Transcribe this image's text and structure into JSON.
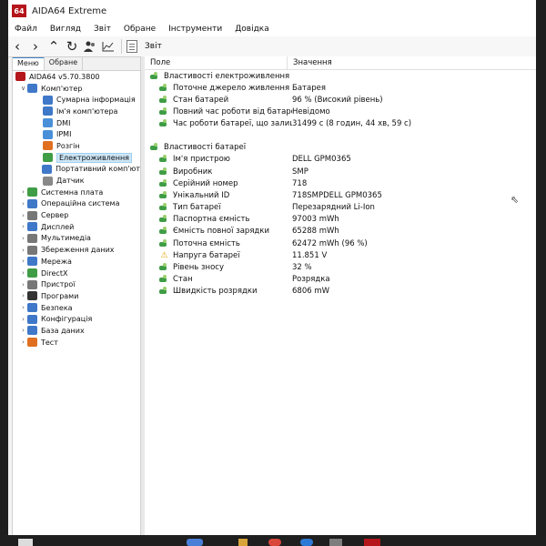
{
  "window": {
    "title": "AIDA64 Extreme",
    "logo": "64"
  },
  "menu": [
    "Файл",
    "Вигляд",
    "Звіт",
    "Обране",
    "Інструменти",
    "Довідка"
  ],
  "toolbar": {
    "report_label": "Звіт",
    "icons": [
      "back-arrow-icon",
      "forward-arrow-icon",
      "up-arrow-icon",
      "refresh-icon",
      "users-icon",
      "chart-icon"
    ]
  },
  "left_panel": {
    "tabs": [
      "Меню",
      "Обране"
    ],
    "tree": [
      {
        "label": "AIDA64 v5.70.3800",
        "icon": "aida-icon",
        "indent": 0,
        "chevron": "",
        "color": "#b5161b"
      },
      {
        "label": "Комп'ютер",
        "icon": "computer-icon",
        "indent": 1,
        "chevron": "v",
        "color": "#3f78c8"
      },
      {
        "label": "Сумарна інформація",
        "icon": "summary-icon",
        "indent": 2,
        "chevron": "",
        "color": "#3f78c8"
      },
      {
        "label": "Ім'я комп'ютера",
        "icon": "computer-name-icon",
        "indent": 2,
        "chevron": "",
        "color": "#3f78c8"
      },
      {
        "label": "DMI",
        "icon": "dmi-icon",
        "indent": 2,
        "chevron": "",
        "color": "#4a90d9"
      },
      {
        "label": "IPMI",
        "icon": "ipmi-icon",
        "indent": 2,
        "chevron": "",
        "color": "#4a90d9"
      },
      {
        "label": "Розгін",
        "icon": "overclock-icon",
        "indent": 2,
        "chevron": "",
        "color": "#e07020"
      },
      {
        "label": "Електроживлення",
        "icon": "power-icon",
        "indent": 2,
        "chevron": "",
        "color": "#3f9d46",
        "selected": true
      },
      {
        "label": "Портативний комп'ют",
        "icon": "portable-icon",
        "indent": 2,
        "chevron": "",
        "color": "#3f78c8"
      },
      {
        "label": "Датчик",
        "icon": "sensor-icon",
        "indent": 2,
        "chevron": "",
        "color": "#888888"
      },
      {
        "label": "Системна плата",
        "icon": "motherboard-icon",
        "indent": 1,
        "chevron": ">",
        "color": "#3f9d46"
      },
      {
        "label": "Операційна система",
        "icon": "os-icon",
        "indent": 1,
        "chevron": ">",
        "color": "#3f78c8"
      },
      {
        "label": "Сервер",
        "icon": "server-icon",
        "indent": 1,
        "chevron": ">",
        "color": "#777777"
      },
      {
        "label": "Дисплей",
        "icon": "display-icon",
        "indent": 1,
        "chevron": ">",
        "color": "#3f78c8"
      },
      {
        "label": "Мультимедіа",
        "icon": "multimedia-icon",
        "indent": 1,
        "chevron": ">",
        "color": "#777777"
      },
      {
        "label": "Збереження даних",
        "icon": "storage-icon",
        "indent": 1,
        "chevron": ">",
        "color": "#777777"
      },
      {
        "label": "Мережа",
        "icon": "network-icon",
        "indent": 1,
        "chevron": ">",
        "color": "#3f78c8"
      },
      {
        "label": "DirectX",
        "icon": "directx-icon",
        "indent": 1,
        "chevron": ">",
        "color": "#3f9d46"
      },
      {
        "label": "Пристрої",
        "icon": "devices-icon",
        "indent": 1,
        "chevron": ">",
        "color": "#777777"
      },
      {
        "label": "Програми",
        "icon": "programs-icon",
        "indent": 1,
        "chevron": ">",
        "color": "#333333"
      },
      {
        "label": "Безпека",
        "icon": "security-icon",
        "indent": 1,
        "chevron": ">",
        "color": "#3f78c8"
      },
      {
        "label": "Конфігурація",
        "icon": "config-icon",
        "indent": 1,
        "chevron": ">",
        "color": "#3f78c8"
      },
      {
        "label": "База даних",
        "icon": "database-icon",
        "indent": 1,
        "chevron": ">",
        "color": "#3f78c8"
      },
      {
        "label": "Тест",
        "icon": "test-icon",
        "indent": 1,
        "chevron": ">",
        "color": "#e07020"
      }
    ]
  },
  "right_panel": {
    "columns": [
      "Поле",
      "Значення"
    ],
    "groups": [
      {
        "title": "Властивості електроживлення",
        "rows": [
          {
            "field": "Поточне джерело живлення",
            "value": "Батарея",
            "icon": "power-prop-icon"
          },
          {
            "field": "Стан батарей",
            "value": "96 % (Високий рівень)",
            "icon": "power-prop-icon"
          },
          {
            "field": "Повний час роботи від батареї",
            "value": "Невідомо",
            "icon": "power-prop-icon"
          },
          {
            "field": "Час роботи батареї, що залиш...",
            "value": "31499 с (8 годин, 44 хв, 59 с)",
            "icon": "power-prop-icon"
          }
        ]
      },
      {
        "title": "Властивості батареї",
        "rows": [
          {
            "field": "Ім'я пристрою",
            "value": "DELL GPM0365",
            "icon": "battery-prop-icon"
          },
          {
            "field": "Виробник",
            "value": "SMP",
            "icon": "battery-prop-icon"
          },
          {
            "field": "Серійний номер",
            "value": "718",
            "icon": "battery-prop-icon"
          },
          {
            "field": "Унікальний ID",
            "value": "718SMPDELL GPM0365",
            "icon": "battery-prop-icon"
          },
          {
            "field": "Тип батареї",
            "value": "Перезарядний Li-Ion",
            "icon": "battery-prop-icon"
          },
          {
            "field": "Паспортна ємність",
            "value": "97003 mWh",
            "icon": "battery-prop-icon"
          },
          {
            "field": "Ємність повної зарядки",
            "value": "65288 mWh",
            "icon": "battery-prop-icon"
          },
          {
            "field": "Поточна ємність",
            "value": "62472 mWh  (96 %)",
            "icon": "battery-prop-icon"
          },
          {
            "field": "Напруга батареї",
            "value": "11.851 V",
            "icon": "warning-icon"
          },
          {
            "field": "Рівень зносу",
            "value": "32 %",
            "icon": "battery-prop-icon"
          },
          {
            "field": "Стан",
            "value": "Розрядка",
            "icon": "battery-prop-icon"
          },
          {
            "field": "Швидкість розрядки",
            "value": "6806 mW",
            "icon": "battery-prop-icon"
          }
        ]
      }
    ]
  }
}
